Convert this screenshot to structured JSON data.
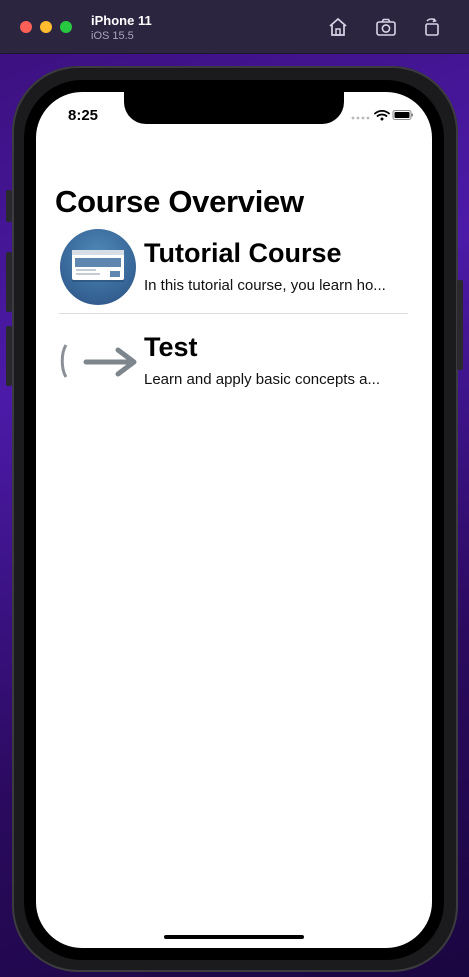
{
  "simulator": {
    "device_name": "iPhone 11",
    "os_version": "iOS 15.5",
    "toolbar": [
      "home-icon",
      "screenshot-camera-icon",
      "rotate-icon"
    ]
  },
  "status_bar": {
    "time": "8:25",
    "icons": [
      "signal-icon",
      "wifi-icon",
      "battery-icon"
    ]
  },
  "page": {
    "title": "Course Overview"
  },
  "courses": [
    {
      "title": "Tutorial Course",
      "description": "In this tutorial course, you learn ho...",
      "icon": "course-slide-icon"
    },
    {
      "title": "Test",
      "description": "Learn and apply basic concepts a...",
      "icon": "arrow-right-icon"
    }
  ],
  "colors": {
    "background_purple": "#4c1aa8",
    "titlebar": "#2b2540",
    "thumb_blue": "#3a6a9c"
  }
}
